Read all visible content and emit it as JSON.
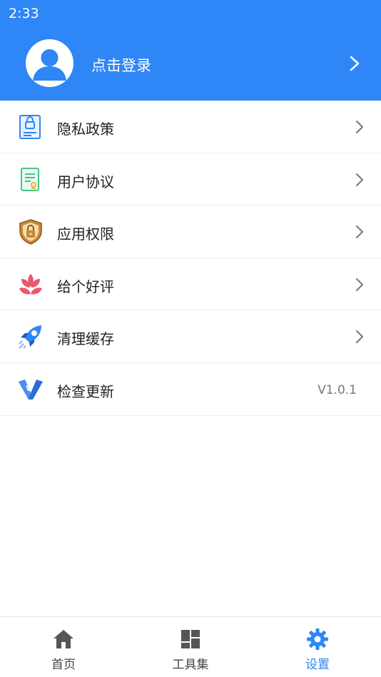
{
  "status_bar": {
    "time": "2:33"
  },
  "header": {
    "login_text": "点击登录"
  },
  "menu": {
    "items": [
      {
        "label": "隐私政策",
        "icon": "privacy-lock-icon"
      },
      {
        "label": "用户协议",
        "icon": "agreement-document-icon"
      },
      {
        "label": "应用权限",
        "icon": "permission-shield-icon"
      },
      {
        "label": "给个好评",
        "icon": "rating-flower-icon"
      },
      {
        "label": "清理缓存",
        "icon": "cleanup-rocket-icon"
      },
      {
        "label": "检查更新",
        "icon": "update-v-icon",
        "value": "V1.0.1"
      }
    ]
  },
  "tabbar": {
    "active_color": "#2f86f6",
    "tabs": [
      {
        "label": "首页",
        "icon": "home-icon"
      },
      {
        "label": "工具集",
        "icon": "grid-tools-icon"
      },
      {
        "label": "设置",
        "icon": "gear-icon",
        "active": true
      }
    ]
  },
  "colors": {
    "header_bg": "#2f86f6"
  }
}
